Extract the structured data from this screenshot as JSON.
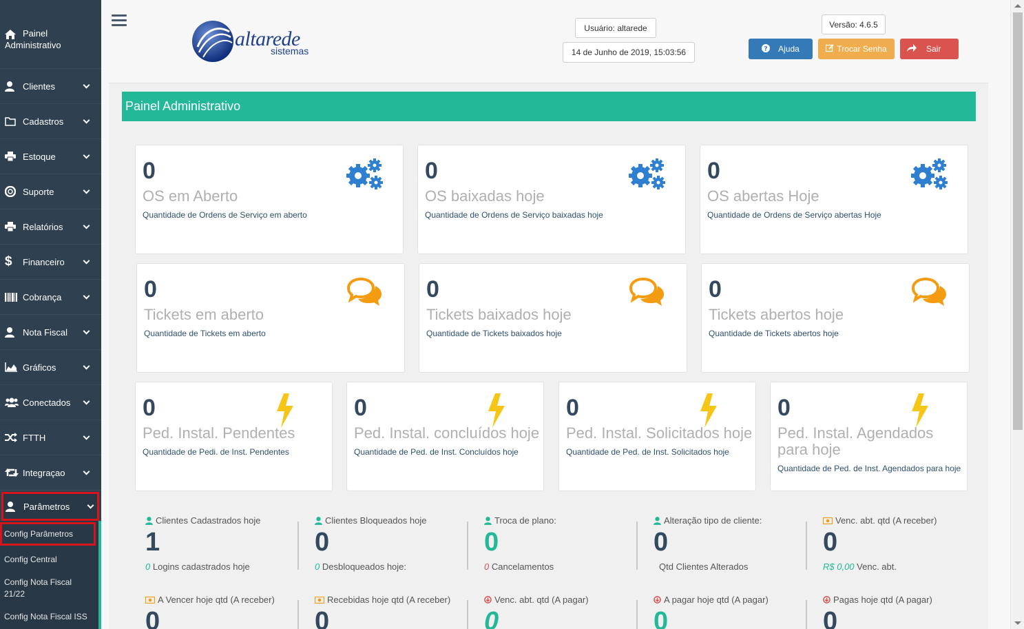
{
  "sidebar": {
    "top_label_line1": "Painel",
    "top_label_line2": "Administrativo",
    "items": [
      {
        "label": "Clientes",
        "icon": "user-icon"
      },
      {
        "label": "Cadastros",
        "icon": "folder-icon"
      },
      {
        "label": "Estoque",
        "icon": "print-icon"
      },
      {
        "label": "Suporte",
        "icon": "lifebuoy-icon"
      },
      {
        "label": "Relatórios",
        "icon": "print-icon"
      },
      {
        "label": "Financeiro",
        "icon": "dollar-icon"
      },
      {
        "label": "Cobrança",
        "icon": "barcode-icon"
      },
      {
        "label": "Nota Fiscal",
        "icon": "user-icon"
      },
      {
        "label": "Gráficos",
        "icon": "area-chart-icon"
      },
      {
        "label": "Conectados",
        "icon": "users-icon"
      },
      {
        "label": "FTTH",
        "icon": "random-icon"
      },
      {
        "label": "Integraçao",
        "icon": "retweet-icon"
      }
    ],
    "active_item": "Parâmetros",
    "submenu": [
      "Config Parâmetros",
      "Config Central",
      "Config Nota Fiscal 21/22",
      "Config Nota Fiscal ISS"
    ]
  },
  "header": {
    "logo_word": "altarede",
    "logo_sub": "sistemas",
    "user": "Usuário: altarede",
    "datetime": "14 de Junho de 2019, 15:03:56",
    "version": "Versão: 4.6.5",
    "help_label": "Ajuda",
    "change_password_label": "Trocar Senha",
    "logout_label": "Sair",
    "colors": {
      "help": "#337ab7",
      "change_password": "#f0ad4e",
      "logout": "#d9534f"
    }
  },
  "panel_title": "Painel Administrativo",
  "cards": [
    {
      "value": "0",
      "title": "OS em Aberto",
      "desc": "Quantidade de Ordens de Serviço em aberto",
      "icon": "gears-icon"
    },
    {
      "value": "0",
      "title": "OS baixadas hoje",
      "desc": "Quantidade de Ordens de Serviço baixadas hoje",
      "icon": "gears-icon"
    },
    {
      "value": "0",
      "title": "OS abertas Hoje",
      "desc": "Quantidade de Ordens de Serviço abertas Hoje",
      "icon": "gears-icon"
    },
    {
      "value": "0",
      "title": "Tickets em aberto",
      "desc": "Quantidade de Tickets em aberto",
      "icon": "comments-icon"
    },
    {
      "value": "0",
      "title": "Tickets baixados hoje",
      "desc": "Quantidade de Tickets baixados hoje",
      "icon": "comments-icon"
    },
    {
      "value": "0",
      "title": "Tickets abertos hoje",
      "desc": "Quantidade de Tickets abertos hoje",
      "icon": "comments-icon"
    },
    {
      "value": "0",
      "title": "Ped. Instal. Pendentes",
      "desc": "Quantidade de Pedi. de Inst. Pendentes",
      "icon": "bolt-icon"
    },
    {
      "value": "0",
      "title": "Ped. Instal. concluídos hoje",
      "desc": "Quantidade de Ped. de Inst. Concluídos hoje",
      "icon": "bolt-icon"
    },
    {
      "value": "0",
      "title": "Ped. Instal. Solicitados hoje",
      "desc": "Quantidade de Ped. de Inst. Solicitados hoje",
      "icon": "bolt-icon"
    },
    {
      "value": "0",
      "title": "Ped. Instal. Agendados para hoje",
      "desc": "Quantidade de Ped. de Inst. Agendados para hoje",
      "icon": "bolt-icon"
    }
  ],
  "stats_row1": [
    {
      "head": "Clientes Cadastrados hoje",
      "icon": "user-icon",
      "value": "1",
      "foot_value": "0",
      "foot_label": "Logins cadastrados hoje"
    },
    {
      "head": "Clientes Bloqueados hoje",
      "icon": "user-icon",
      "value": "0",
      "foot_value": "0",
      "foot_label": "Desbloqueados hoje:"
    },
    {
      "head": "Troca de plano:",
      "icon": "user-icon",
      "value": "0",
      "foot_value": "0",
      "foot_label": "Cancelamentos"
    },
    {
      "head": "Alteração tipo de cliente:",
      "icon": "user-icon",
      "value": "0",
      "foot_value": "",
      "foot_label": "Qtd Clientes Alterados"
    },
    {
      "head": "Venc. abt. qtd (A receber)",
      "icon": "money-icon",
      "value": "0",
      "foot_value": "R$ 0,00",
      "foot_label": "Venc. abt."
    }
  ],
  "stats_row2": [
    {
      "head": "A Vencer hoje qtd (A receber)",
      "icon": "money-icon",
      "value": "0"
    },
    {
      "head": "Recebidas hoje qtd (A receber)",
      "icon": "money-icon",
      "value": "0"
    },
    {
      "head": "Venc. abt. qtd (A pagar)",
      "icon": "arrow-circle-down-icon",
      "value": "0"
    },
    {
      "head": "A pagar hoje qtd (A pagar)",
      "icon": "arrow-circle-down-icon",
      "value": "0"
    },
    {
      "head": "Pagas hoje qtd (A pagar)",
      "icon": "arrow-circle-down-icon",
      "value": "0"
    }
  ]
}
